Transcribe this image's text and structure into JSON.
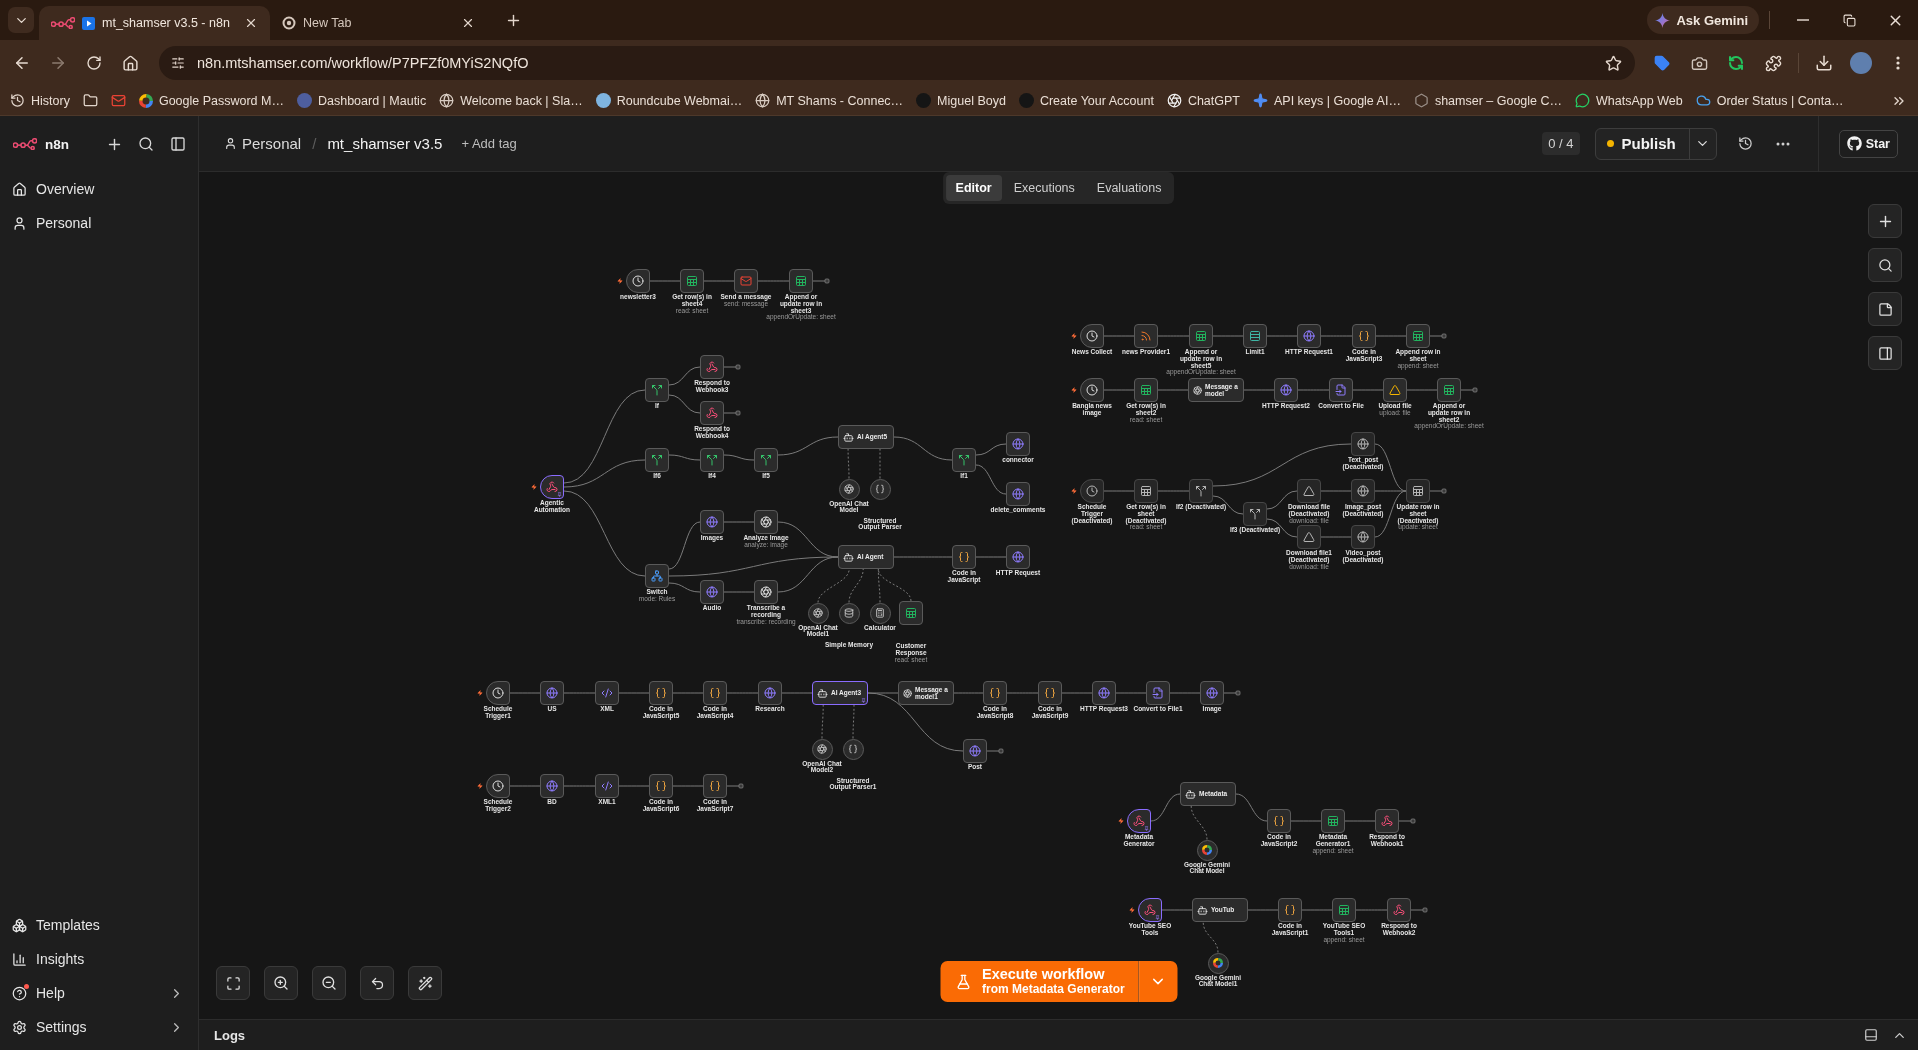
{
  "browser": {
    "tabs": [
      {
        "title": "mt_shamser v3.5 - n8n",
        "selected": true
      },
      {
        "title": "New Tab",
        "selected": false
      }
    ],
    "ask_gemini": "Ask Gemini",
    "url": "n8n.mtshamser.com/workflow/P7PFZf0MYiS2NQfO",
    "bookmarks": [
      {
        "kind": "history",
        "label": "History"
      },
      {
        "kind": "folder"
      },
      {
        "kind": "gmail"
      },
      {
        "kind": "google",
        "label": "Google Password M…"
      },
      {
        "kind": "mautic",
        "label": "Dashboard | Mautic"
      },
      {
        "kind": "globe",
        "label": "Welcome back | Sla…"
      },
      {
        "kind": "roundcube",
        "label": "Roundcube Webmai…"
      },
      {
        "kind": "globe",
        "label": "MT Shams - Connec…"
      },
      {
        "kind": "avatar",
        "label": "Miguel Boyd"
      },
      {
        "kind": "avatar",
        "label": "Create Your Account"
      },
      {
        "kind": "openai",
        "label": "ChatGPT"
      },
      {
        "kind": "ai_studio",
        "label": "API keys | Google AI…"
      },
      {
        "kind": "hexagon",
        "label": "shamser – Google C…"
      },
      {
        "kind": "whatsapp",
        "label": "WhatsApp Web"
      },
      {
        "kind": "cloud",
        "label": "Order Status | Conta…"
      }
    ]
  },
  "sidebar": {
    "logo": "n8n",
    "nav": [
      {
        "label": "Overview"
      },
      {
        "label": "Personal"
      }
    ],
    "footer": [
      {
        "label": "Templates",
        "notification": false,
        "submenu": false
      },
      {
        "label": "Insights",
        "notification": false,
        "submenu": false
      },
      {
        "label": "Help",
        "notification": true,
        "submenu": true
      },
      {
        "label": "Settings",
        "notification": false,
        "submenu": true
      }
    ]
  },
  "header": {
    "project": "Personal",
    "separator": "/",
    "workflow_name": "mt_shamser v3.5",
    "add_tag": "+ Add tag",
    "version_counter": "0 / 4",
    "publish": {
      "label": "Publish",
      "unpublished_changes": true
    },
    "star": "Star"
  },
  "view_tabs": [
    {
      "label": "Editor",
      "selected": true
    },
    {
      "label": "Executions",
      "selected": false
    },
    {
      "label": "Evaluations",
      "selected": false
    }
  ],
  "canvas": {
    "nodes": [
      {
        "name": "newsletter3",
        "kind": "schedule",
        "disabled": false,
        "pinned": false
      },
      {
        "name": "Get row(s) in sheet4",
        "subtitle": "read: sheet",
        "kind": "sheets",
        "disabled": false,
        "pinned": false
      },
      {
        "name": "Send a message",
        "subtitle": "send: message",
        "kind": "gmail",
        "disabled": false,
        "pinned": false
      },
      {
        "name": "Append or update row in sheet3",
        "subtitle": "appendOrUpdate: sheet",
        "kind": "sheets",
        "disabled": false,
        "pinned": false
      },
      {
        "name": "News Collect",
        "kind": "schedule",
        "disabled": false,
        "pinned": false
      },
      {
        "name": "news Provider1",
        "kind": "rss",
        "disabled": false,
        "pinned": false
      },
      {
        "name": "Append or update row in sheet5",
        "subtitle": "appendOrUpdate: sheet",
        "kind": "sheets",
        "disabled": false,
        "pinned": false
      },
      {
        "name": "Limit1",
        "kind": "limit",
        "disabled": false,
        "pinned": false
      },
      {
        "name": "HTTP Request1",
        "kind": "http",
        "disabled": false,
        "pinned": false
      },
      {
        "name": "Code in JavaScript3",
        "kind": "code",
        "disabled": false,
        "pinned": false
      },
      {
        "name": "Append row in sheet",
        "subtitle": "append: sheet",
        "kind": "sheets",
        "disabled": false,
        "pinned": false
      },
      {
        "name": "Respond to Webhook3",
        "kind": "webhook_respond",
        "disabled": false,
        "pinned": false
      },
      {
        "name": "If",
        "kind": "if",
        "disabled": false,
        "pinned": false
      },
      {
        "name": "Bangla news image",
        "kind": "schedule",
        "disabled": false,
        "pinned": false
      },
      {
        "name": "Get row(s) in sheet2",
        "subtitle": "read: sheet",
        "kind": "sheets",
        "disabled": false,
        "pinned": false
      },
      {
        "name": "Message a model",
        "kind": "message_model",
        "disabled": false,
        "pinned": false
      },
      {
        "name": "HTTP Request2",
        "kind": "http",
        "disabled": false,
        "pinned": false
      },
      {
        "name": "Convert to File",
        "kind": "convert",
        "disabled": false,
        "pinned": false
      },
      {
        "name": "Upload file",
        "subtitle": "upload: file",
        "kind": "drive",
        "disabled": false,
        "pinned": false
      },
      {
        "name": "Append or update row in sheet2",
        "subtitle": "appendOrUpdate: sheet",
        "kind": "sheets",
        "disabled": false,
        "pinned": false
      },
      {
        "name": "Respond to Webhook4",
        "kind": "webhook_respond",
        "disabled": false,
        "pinned": false
      },
      {
        "name": "AI Agent5",
        "kind": "agent",
        "disabled": false,
        "pinned": false
      },
      {
        "name": "connector",
        "kind": "http",
        "disabled": false,
        "pinned": false
      },
      {
        "name": "Text_post (Deactivated)",
        "kind": "http",
        "disabled": true,
        "pinned": false
      },
      {
        "name": "If6",
        "kind": "if",
        "disabled": false,
        "pinned": false
      },
      {
        "name": "If4",
        "kind": "if",
        "disabled": false,
        "pinned": false
      },
      {
        "name": "If5",
        "kind": "if",
        "disabled": false,
        "pinned": false
      },
      {
        "name": "If1",
        "kind": "if",
        "disabled": false,
        "pinned": false
      },
      {
        "name": "Agentic Automation",
        "kind": "webhook_trigger",
        "disabled": false,
        "pinned": true
      },
      {
        "name": "OpenAI Chat Model",
        "kind": "openai_model",
        "disabled": false,
        "pinned": false
      },
      {
        "name": "Structured Output Parser",
        "kind": "parser",
        "disabled": false,
        "pinned": false
      },
      {
        "name": "delete_comments",
        "kind": "http",
        "disabled": false,
        "pinned": false
      },
      {
        "name": "Schedule Trigger (Deactivated)",
        "kind": "schedule",
        "disabled": true,
        "pinned": false
      },
      {
        "name": "Get row(s) in sheet (Deactivated)",
        "subtitle": "read: sheet",
        "kind": "sheets",
        "disabled": true,
        "pinned": false
      },
      {
        "name": "If2 (Deactivated)",
        "kind": "if",
        "disabled": true,
        "pinned": false
      },
      {
        "name": "Download file (Deactivated)",
        "subtitle": "download: file",
        "kind": "drive_download",
        "disabled": true,
        "pinned": false
      },
      {
        "name": "Image_post (Deactivated)",
        "kind": "http",
        "disabled": true,
        "pinned": false
      },
      {
        "name": "Update row in sheet (Deactivated)",
        "subtitle": "update: sheet",
        "kind": "sheets",
        "disabled": true,
        "pinned": false
      },
      {
        "name": "Images",
        "kind": "http",
        "disabled": false,
        "pinned": false
      },
      {
        "name": "Analyze Image",
        "subtitle": "analyze: image",
        "kind": "openai",
        "disabled": false,
        "pinned": false
      },
      {
        "name": "If3 (Deactivated)",
        "kind": "if",
        "disabled": true,
        "pinned": false
      },
      {
        "name": "AI Agent",
        "kind": "agent",
        "disabled": false,
        "pinned": false
      },
      {
        "name": "Download file1 (Deactivated)",
        "subtitle": "download: file",
        "kind": "drive_download",
        "disabled": true,
        "pinned": false
      },
      {
        "name": "Video_post (Deactivated)",
        "kind": "http",
        "disabled": true,
        "pinned": false
      },
      {
        "name": "Code in JavaScript",
        "kind": "code",
        "disabled": false,
        "pinned": false
      },
      {
        "name": "HTTP Request",
        "kind": "http",
        "disabled": false,
        "pinned": false
      },
      {
        "name": "Switch",
        "subtitle": "mode: Rules",
        "kind": "switch",
        "disabled": false,
        "pinned": false
      },
      {
        "name": "Audio",
        "kind": "http",
        "disabled": false,
        "pinned": false
      },
      {
        "name": "Transcribe a recording",
        "subtitle": "transcribe: recording",
        "kind": "openai",
        "disabled": false,
        "pinned": false
      },
      {
        "name": "OpenAI Chat Model1",
        "kind": "openai_model",
        "disabled": false,
        "pinned": false
      },
      {
        "name": "Simple Memory",
        "kind": "memory",
        "disabled": false,
        "pinned": false
      },
      {
        "name": "Calculator",
        "kind": "calculator",
        "disabled": false,
        "pinned": false
      },
      {
        "name": "Customer Response",
        "subtitle": "read: sheet",
        "kind": "sheets",
        "disabled": false,
        "pinned": false
      },
      {
        "name": "Schedule Trigger1",
        "kind": "schedule",
        "disabled": false,
        "pinned": false
      },
      {
        "name": "US",
        "kind": "http",
        "disabled": false,
        "pinned": false
      },
      {
        "name": "XML",
        "kind": "xml",
        "disabled": false,
        "pinned": false
      },
      {
        "name": "Code in JavaScript5",
        "kind": "code",
        "disabled": false,
        "pinned": false
      },
      {
        "name": "Code in JavaScript4",
        "kind": "code",
        "disabled": false,
        "pinned": false
      },
      {
        "name": "Research",
        "kind": "http",
        "disabled": false,
        "pinned": false
      },
      {
        "name": "AI Agent3",
        "kind": "agent",
        "disabled": false,
        "pinned": true
      },
      {
        "name": "Message a model1",
        "kind": "message_model",
        "disabled": false,
        "pinned": false
      },
      {
        "name": "Code in JavaScript8",
        "kind": "code",
        "disabled": false,
        "pinned": false
      },
      {
        "name": "Code in JavaScript9",
        "kind": "code",
        "disabled": false,
        "pinned": false
      },
      {
        "name": "HTTP Request3",
        "kind": "http",
        "disabled": false,
        "pinned": false
      },
      {
        "name": "Convert to File1",
        "kind": "convert",
        "disabled": false,
        "pinned": false
      },
      {
        "name": "Image",
        "kind": "http",
        "disabled": false,
        "pinned": false
      },
      {
        "name": "OpenAI Chat Model2",
        "kind": "openai_model",
        "disabled": false,
        "pinned": false
      },
      {
        "name": "Structured Output Parser1",
        "kind": "parser",
        "disabled": false,
        "pinned": false
      },
      {
        "name": "Post",
        "kind": "http",
        "disabled": false,
        "pinned": false
      },
      {
        "name": "Schedule Trigger2",
        "kind": "schedule",
        "disabled": false,
        "pinned": false
      },
      {
        "name": "BD",
        "kind": "http",
        "disabled": false,
        "pinned": false
      },
      {
        "name": "XML1",
        "kind": "xml",
        "disabled": false,
        "pinned": false
      },
      {
        "name": "Code in JavaScript6",
        "kind": "code",
        "disabled": false,
        "pinned": false
      },
      {
        "name": "Code in JavaScript7",
        "kind": "code",
        "disabled": false,
        "pinned": false
      },
      {
        "name": "Metadata",
        "kind": "agent",
        "disabled": false,
        "pinned": false
      },
      {
        "name": "Metadata Generator",
        "kind": "webhook_trigger",
        "disabled": false,
        "pinned": true
      },
      {
        "name": "Code in JavaScript2",
        "kind": "code",
        "disabled": false,
        "pinned": false
      },
      {
        "name": "Metadata Generator1",
        "subtitle": "append: sheet",
        "kind": "sheets",
        "disabled": false,
        "pinned": false
      },
      {
        "name": "Respond to Webhook1",
        "kind": "webhook_respond",
        "disabled": false,
        "pinned": false
      },
      {
        "name": "Google Gemini Chat Model",
        "kind": "gemini",
        "disabled": false,
        "pinned": false
      },
      {
        "name": "YouTube SEO Tools",
        "kind": "webhook_trigger",
        "disabled": false,
        "pinned": true
      },
      {
        "name": "YouTub",
        "kind": "agent",
        "disabled": false,
        "pinned": false
      },
      {
        "name": "Code in JavaScript1",
        "kind": "code",
        "disabled": false,
        "pinned": false
      },
      {
        "name": "YouTube SEO Tools1",
        "subtitle": "append: sheet",
        "kind": "sheets",
        "disabled": false,
        "pinned": false
      },
      {
        "name": "Respond to Webhook2",
        "kind": "webhook_respond",
        "disabled": false,
        "pinned": false
      },
      {
        "name": "Google Gemini Chat Model1",
        "kind": "gemini",
        "disabled": false,
        "pinned": false
      }
    ]
  },
  "execute_button": {
    "title": "Execute workflow",
    "subtitle": "from Metadata Generator"
  },
  "logs_panel": {
    "title": "Logs"
  }
}
